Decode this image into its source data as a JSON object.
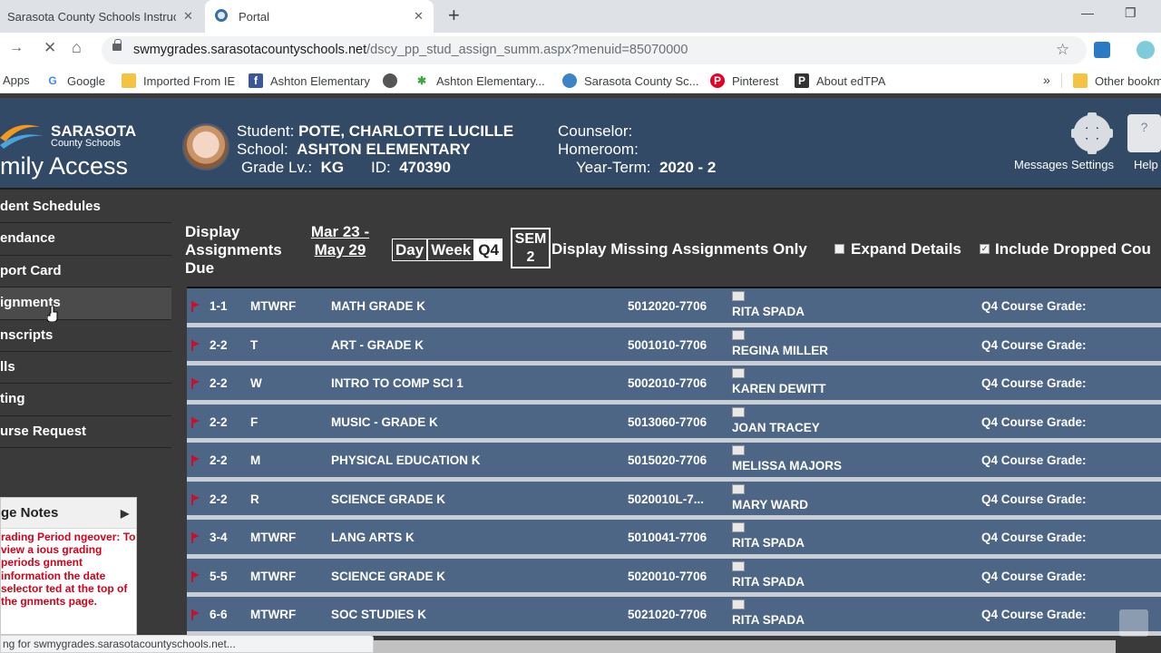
{
  "browser": {
    "tabs": [
      {
        "title": "Sarasota County Schools Instructi"
      },
      {
        "title": "Portal"
      }
    ],
    "new_tab": "+",
    "url_host": "swmygrades.sarasotacountyschools.net",
    "url_path": "/dscy_pp_stud_assign_summ.aspx?menuid=85070000",
    "bookmarks": [
      {
        "label": "Apps",
        "icon": "apps-grid-icon"
      },
      {
        "label": "Google",
        "icon": "google-icon"
      },
      {
        "label": "Imported From IE",
        "icon": "folder-icon"
      },
      {
        "label": "Ashton Elementary",
        "icon": "facebook-icon"
      },
      {
        "label": "Ashton Elementary...",
        "icon": "palm-tree-icon"
      },
      {
        "label": "Sarasota County Sc...",
        "icon": "globe-blue-icon"
      },
      {
        "label": "Pinterest",
        "icon": "pinterest-icon"
      },
      {
        "label": "About edTPA",
        "icon": "p-icon"
      }
    ],
    "bookmarks_overflow": "»",
    "other_bookmarks": "Other bookm",
    "status_text": "ng for swmygrades.sarasotacountyschools.net..."
  },
  "header": {
    "logo_top": "SARASOTA",
    "logo_sub": "County Schools",
    "logo_big": "mily Access",
    "student_label": "Student:",
    "student_name": "POTE, CHARLOTTE LUCILLE",
    "school_label": "School:",
    "school_name": "ASHTON ELEMENTARY",
    "grade_label": "Grade Lv.:",
    "grade_value": "KG",
    "id_label": "ID:",
    "id_value": "470390",
    "counselor_label": "Counselor:",
    "homeroom_label": "Homeroom:",
    "yearterm_label": "Year-Term:",
    "yearterm_value": "2020 - 2",
    "messages_label": "Messages",
    "settings_label": "Settings",
    "help_label": "Help",
    "help_glyph": "?"
  },
  "sidemenu": [
    {
      "label": "dent Schedules"
    },
    {
      "label": "endance"
    },
    {
      "label": "port Card"
    },
    {
      "label": "ignments"
    },
    {
      "label": "nscripts"
    },
    {
      "label": "lls"
    },
    {
      "label": "ting"
    },
    {
      "label": "urse Request"
    }
  ],
  "notes": {
    "title": "ge Notes",
    "body": "rading Period ngeover: To view a ious grading periods gnment information the date selector ted at the top of the gnments page."
  },
  "controls": {
    "display_label": "Display Assignments Due",
    "date_range": "Mar 23 - May 29",
    "periods": [
      "Day",
      "Week",
      "Q4"
    ],
    "selected_period": "Q4",
    "sem_label": "SEM 2",
    "missing_label": "Display Missing Assignments Only",
    "expand_label": "Expand Details",
    "include_dropped_label": "Include Dropped Cou",
    "include_dropped_checked": "✓"
  },
  "courses": [
    {
      "period": "1-1",
      "days": "MTWRF",
      "name": "MATH GRADE K",
      "code": "5012020-7706",
      "teacher": "RITA SPADA",
      "grade_label": "Q4 Course Grade:"
    },
    {
      "period": "2-2",
      "days": "T",
      "name": "ART - GRADE K",
      "code": "5001010-7706",
      "teacher": "REGINA MILLER",
      "grade_label": "Q4 Course Grade:"
    },
    {
      "period": "2-2",
      "days": "W",
      "name": "INTRO TO COMP SCI 1",
      "code": "5002010-7706",
      "teacher": "KAREN DEWITT",
      "grade_label": "Q4 Course Grade:"
    },
    {
      "period": "2-2",
      "days": "F",
      "name": "MUSIC - GRADE K",
      "code": "5013060-7706",
      "teacher": "JOAN TRACEY",
      "grade_label": "Q4 Course Grade:"
    },
    {
      "period": "2-2",
      "days": "M",
      "name": "PHYSICAL EDUCATION K",
      "code": "5015020-7706",
      "teacher": "MELISSA MAJORS",
      "grade_label": "Q4 Course Grade:"
    },
    {
      "period": "2-2",
      "days": "R",
      "name": "SCIENCE GRADE K",
      "code": "5020010L-7...",
      "teacher": "MARY WARD",
      "grade_label": "Q4 Course Grade:"
    },
    {
      "period": "3-4",
      "days": "MTWRF",
      "name": "LANG ARTS K",
      "code": "5010041-7706",
      "teacher": "RITA SPADA",
      "grade_label": "Q4 Course Grade:"
    },
    {
      "period": "5-5",
      "days": "MTWRF",
      "name": "SCIENCE GRADE K",
      "code": "5020010-7706",
      "teacher": "RITA SPADA",
      "grade_label": "Q4 Course Grade:"
    },
    {
      "period": "6-6",
      "days": "MTWRF",
      "name": "SOC STUDIES K",
      "code": "5021020-7706",
      "teacher": "RITA SPADA",
      "grade_label": "Q4 Course Grade:"
    }
  ],
  "colors": {
    "header_bg": "#324a66",
    "row_bg": "#4d6686",
    "flag_red": "#c8102e",
    "notes_red": "#d0021b"
  }
}
